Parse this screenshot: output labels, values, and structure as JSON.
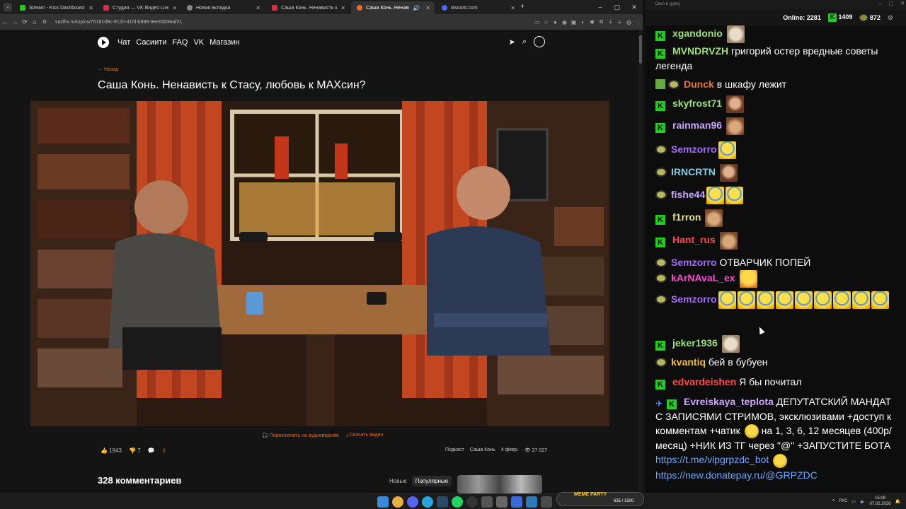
{
  "browser": {
    "tabs": [
      {
        "title": "Stream - Kick Dashboard",
        "color": "#1ed01e",
        "active": false
      },
      {
        "title": "Студия — VK Видео Live",
        "color": "#e02a4a",
        "active": false
      },
      {
        "title": "Новая вкладка",
        "color": "#888888",
        "active": false
      },
      {
        "title": "Саша Конь. Ненависть к Стасу",
        "color": "#e02a4a",
        "active": false
      },
      {
        "title": "Саша Конь. Ненависть к С",
        "color": "#e26c2c",
        "active": true
      },
      {
        "title": "discord.com",
        "color": "#5865f2",
        "active": false
      }
    ],
    "url": "sasflix.ru/topics/75181d9c-9120-41fd-b999-9ee00b94af21",
    "new_tab": "+",
    "window_controls": [
      "–",
      "▢",
      "✕"
    ]
  },
  "site": {
    "nav": [
      "Чат",
      "Сасиити",
      "FAQ",
      "VK",
      "Магазин"
    ],
    "back": "← Назад",
    "title": "Саша Конь. Ненависть к Стасу, любовь к МАХсин?",
    "video_links": [
      "🎧 Переключить на аудиоверсию",
      "⤓ Скачать видео"
    ],
    "likes": "1943",
    "dislikes": "7",
    "meta": [
      "Подкаст",
      "Саша Конь",
      "4 февр.",
      "27 027"
    ],
    "comments_title": "328 комментариев",
    "sort": [
      "Новые",
      "Популярные"
    ]
  },
  "chat": {
    "window_title": "Окно в дурку",
    "online_label": "Online:",
    "online": "2281",
    "kick_count": "1409",
    "coin_count": "872",
    "messages": [
      {
        "badges": [
          "k"
        ],
        "user": "xgandonio",
        "color": "#9fe07a",
        "text": "",
        "emotes": [
          "cat"
        ]
      },
      {
        "badges": [
          "k"
        ],
        "user": "MVNDRVZH",
        "color": "#9fe07a",
        "text": "григорий остер вредные советы легенда",
        "emotes": []
      },
      {
        "badges": [
          "p",
          "c"
        ],
        "user": "Dunck",
        "color": "#e07b2e",
        "text": "в шкафу лежит",
        "emotes": []
      },
      {
        "badges": [
          "k"
        ],
        "user": "skyfrost71",
        "color": "#9fe07a",
        "text": "",
        "emotes": [
          "face"
        ]
      },
      {
        "badges": [
          "k"
        ],
        "user": "rainman96",
        "color": "#c8a8ff",
        "text": "",
        "emotes": [
          "dog"
        ]
      },
      {
        "badges": [
          "c"
        ],
        "user": "Semzorro",
        "color": "#a46cff",
        "text": "",
        "emotes": [
          "laugh"
        ]
      },
      {
        "badges": [
          "c"
        ],
        "user": "IRNCRTN",
        "color": "#7ad0e8",
        "text": "",
        "emotes": [
          "face"
        ]
      },
      {
        "badges": [
          "c"
        ],
        "user": "fishe44",
        "color": "#c8a8ff",
        "text": "",
        "emotes": [
          "laugh",
          "laugh"
        ]
      },
      {
        "badges": [
          "k"
        ],
        "user": "f1rron",
        "color": "#e8e08a",
        "text": "",
        "emotes": [
          "dog"
        ]
      },
      {
        "badges": [
          "k"
        ],
        "user": "Hant_rus",
        "color": "#ff4a4a",
        "text": "",
        "emotes": [
          "dog"
        ]
      },
      {
        "badges": [
          "c"
        ],
        "user": "Semzorro",
        "color": "#a46cff",
        "text": "ОТВАРЧИК ПОПЕЙ",
        "emotes": []
      },
      {
        "badges": [
          "c"
        ],
        "user": "kArNAvaL_ex",
        "color": "#ff4ad0",
        "text": "",
        "emotes": [
          "cry"
        ]
      },
      {
        "badges": [
          "c"
        ],
        "user": "Semzorro",
        "color": "#a46cff",
        "text": "",
        "emotes": [
          "laugh",
          "laugh",
          "laugh",
          "laugh",
          "laugh",
          "laugh",
          "laugh",
          "laugh",
          "laugh"
        ]
      },
      {
        "badges": [
          "k"
        ],
        "user": "jeker1936",
        "color": "#9fe07a",
        "text": "",
        "emotes": [
          "cat"
        ]
      },
      {
        "badges": [
          "c"
        ],
        "user": "kvantiq",
        "color": "#f0c030",
        "text": "бей в бубуен",
        "emotes": []
      },
      {
        "badges": [
          "k"
        ],
        "user": "edvardeishen",
        "color": "#ff4a4a",
        "text": "Я бы почитал",
        "emotes": []
      },
      {
        "badges": [
          "s",
          "k"
        ],
        "user": "Evreiskaya_teplota",
        "color": "#c8a8ff",
        "text": "ДЕПУТАТСКИЙ МАНДАТ С ЗАПИСЯМИ СТРИМОВ, эксклюзивами +доступ к комментам +чатик",
        "text2": "на 1, 3, 6, 12 месяцев (400р/месяц) +НИК ИЗ ТГ через \"@\" +ЗАПУСТИТЕ БОТА",
        "link1": "https://t.me/vipgrpzdc_bot",
        "link2": "https://new.donatepay.ru/@GRPZDC"
      }
    ]
  },
  "taskbar": {
    "meme": "MEME PARTY",
    "meme_progress": "635 / 1500",
    "lang": "РУС",
    "time": "15:08",
    "date": "07.02.2026"
  }
}
